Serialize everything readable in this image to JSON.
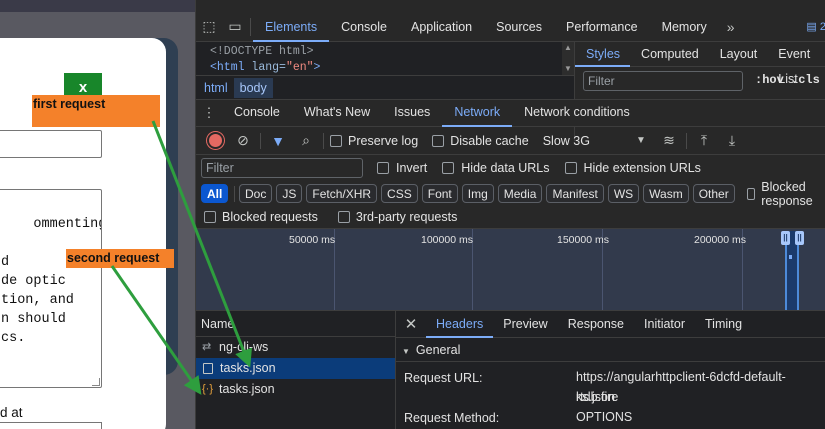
{
  "app": {
    "close_label": "x",
    "textarea_text": "ommenting\n\nd\nde optic\ntion, and\nn should\ncs.",
    "label_bottom": "d at"
  },
  "devtools": {
    "top_tabs": [
      "Elements",
      "Console",
      "Application",
      "Sources",
      "Performance",
      "Memory"
    ],
    "top_tab_active": "Elements",
    "more_tabs": "»",
    "badge": "2",
    "elements": {
      "line1": "<!DOCTYPE html>",
      "line2_tag": "<html",
      "line2_attr": "lang=",
      "line2_val": "\"en\"",
      "line2_end": ">",
      "breadcrumbs": [
        "html",
        "body"
      ]
    },
    "styles": {
      "tabs": [
        "Styles",
        "Computed",
        "Layout",
        "Event List"
      ],
      "filter_placeholder": "Filter",
      "hov": ":hov",
      "cls": ".cls"
    },
    "drawer_tabs": [
      "Console",
      "What's New",
      "Issues",
      "Network",
      "Network conditions"
    ],
    "drawer_active": "Network",
    "toolbar": {
      "preserve_log": "Preserve log",
      "disable_cache": "Disable cache",
      "throttle": "Slow 3G"
    },
    "filter": {
      "placeholder": "Filter",
      "invert": "Invert",
      "hide_data_urls": "Hide data URLs",
      "hide_extension_urls": "Hide extension URLs"
    },
    "types": [
      "All",
      "Doc",
      "JS",
      "Fetch/XHR",
      "CSS",
      "Font",
      "Img",
      "Media",
      "Manifest",
      "WS",
      "Wasm",
      "Other"
    ],
    "blocked_response": "Blocked response",
    "blocked_requests": "Blocked requests",
    "third_party": "3rd-party requests",
    "timeline_ticks": [
      "50000 ms",
      "100000 ms",
      "150000 ms",
      "200000 ms"
    ],
    "requests": {
      "header": "Name",
      "items": [
        {
          "name": "ng-cli-ws",
          "icon": "websocket-icon"
        },
        {
          "name": "tasks.json",
          "icon": "document-icon"
        },
        {
          "name": "tasks.json",
          "icon": "fetch-icon"
        }
      ]
    },
    "detail": {
      "tabs": [
        "Headers",
        "Preview",
        "Response",
        "Initiator",
        "Timing"
      ],
      "active": "Headers",
      "section": "General",
      "request_url_label": "Request URL:",
      "request_url_value_1": "https://angularhttpclient-6dcfd-default-rtdb.fire",
      "request_url_value_2": "ks.json",
      "request_method_label": "Request Method:",
      "request_method_value": "OPTIONS"
    }
  },
  "annotations": {
    "first": "first request",
    "second": "second request",
    "color": "#f4812a",
    "arrow_color": "#2e9e3e"
  }
}
